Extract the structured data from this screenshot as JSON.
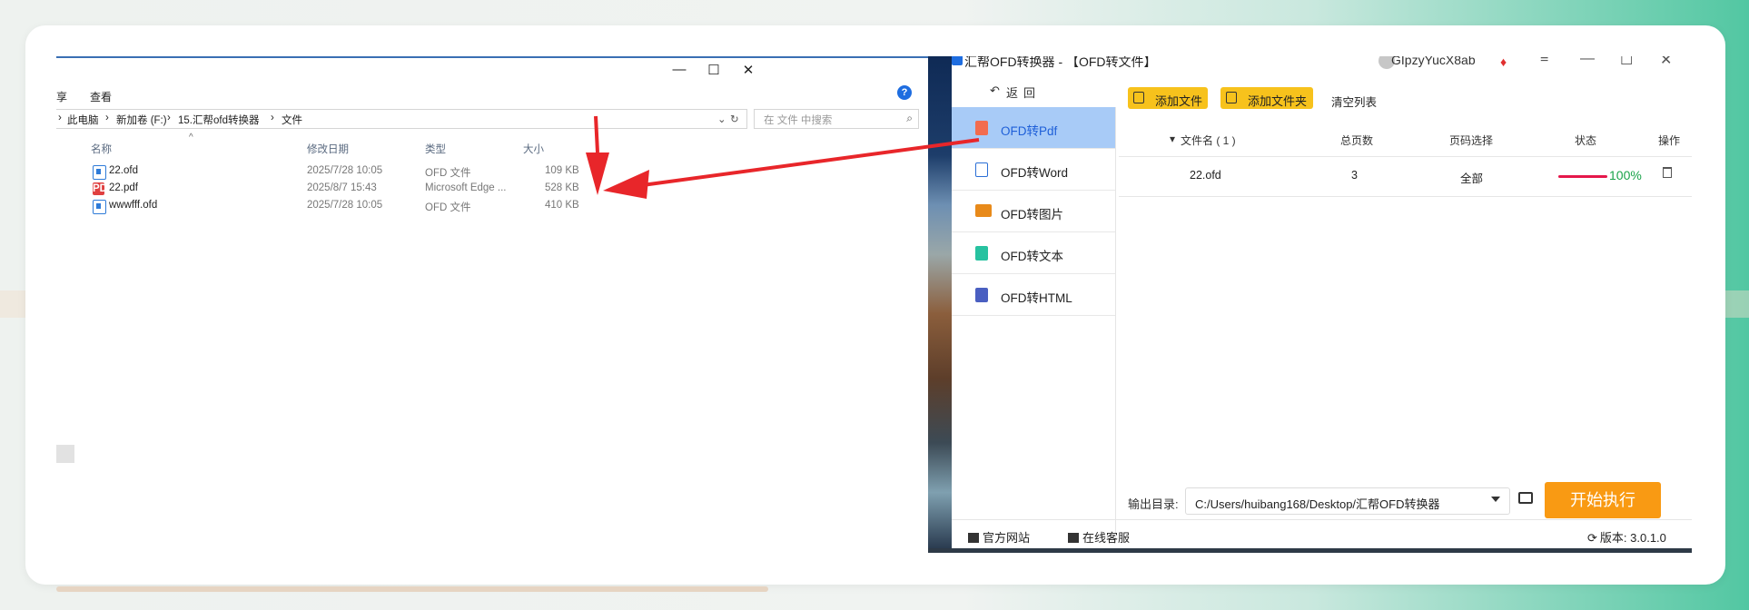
{
  "explorer": {
    "menu": [
      "享",
      "查看"
    ],
    "window_controls": {
      "minimize": "—",
      "maximize": "☐",
      "close": "✕"
    },
    "breadcrumb": [
      "›",
      "此电脑",
      "›",
      "新加卷 (F:)",
      "›",
      "15.汇帮ofd转换器",
      "›",
      "文件"
    ],
    "search_placeholder": "在 文件 中搜索",
    "columns": {
      "name": "名称",
      "modified": "修改日期",
      "type": "类型",
      "size": "大小"
    },
    "files": [
      {
        "name": "22.ofd",
        "modified": "2025/7/28 10:05",
        "type": "OFD 文件",
        "size": "109 KB",
        "icon": "ofd-file-icon"
      },
      {
        "name": "22.pdf",
        "modified": "2025/8/7 15:43",
        "type": "Microsoft Edge ...",
        "size": "528 KB",
        "icon": "pdf-file-icon"
      },
      {
        "name": "wwwfff.ofd",
        "modified": "2025/7/28 10:05",
        "type": "OFD 文件",
        "size": "410 KB",
        "icon": "ofd-file-icon"
      }
    ]
  },
  "app": {
    "title": "汇帮OFD转换器 - 【OFD转文件】",
    "user": "GIpzyYucX8ab",
    "back": "返回",
    "sidebar": [
      {
        "label": "OFD转Pdf",
        "icon": "pdf-icon",
        "color": "#f26c4f",
        "active": true
      },
      {
        "label": "OFD转Word",
        "icon": "word-icon",
        "color": "#2b6fd6"
      },
      {
        "label": "OFD转图片",
        "icon": "image-icon",
        "color": "#e88a1a"
      },
      {
        "label": "OFD转文本",
        "icon": "text-icon",
        "color": "#27c2a0"
      },
      {
        "label": "OFD转HTML",
        "icon": "html-icon",
        "color": "#4a5fc1"
      }
    ],
    "toolbar": {
      "add_file": "添加文件",
      "add_folder": "添加文件夹",
      "clear": "清空列表"
    },
    "table": {
      "headers": {
        "filename": "文件名 ( 1 )",
        "pages": "总页数",
        "page_select": "页码选择",
        "status": "状态",
        "action": "操作"
      },
      "rows": [
        {
          "filename": "22.ofd",
          "pages": "3",
          "page_select": "全部",
          "progress": "100%"
        }
      ]
    },
    "output_label": "输出目录:",
    "output_path": "C:/Users/huibang168/Desktop/汇帮OFD转换器",
    "start_button": "开始执行",
    "footer": {
      "website": "官方网站",
      "support": "在线客服",
      "version": "版本: 3.0.1.0"
    }
  }
}
